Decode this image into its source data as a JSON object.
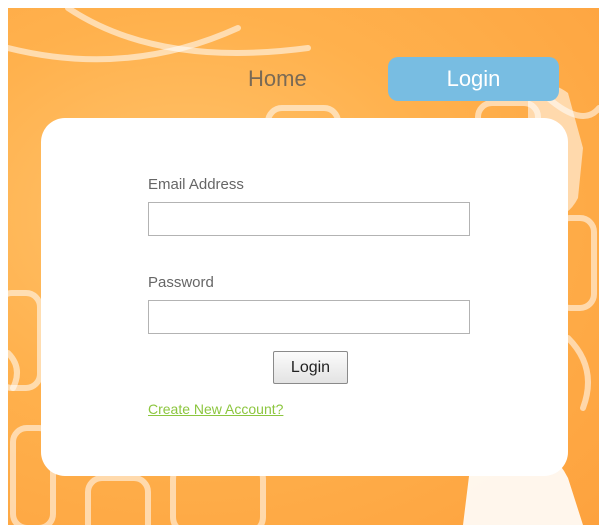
{
  "nav": {
    "home_label": "Home",
    "login_label": "Login"
  },
  "form": {
    "email_label": "Email Address",
    "email_value": "",
    "password_label": "Password",
    "password_value": "",
    "submit_label": "Login",
    "create_account_label": "Create New Account?"
  },
  "colors": {
    "background": "#fdab45",
    "nav_active": "#78bde2",
    "link": "#8cc63f"
  }
}
